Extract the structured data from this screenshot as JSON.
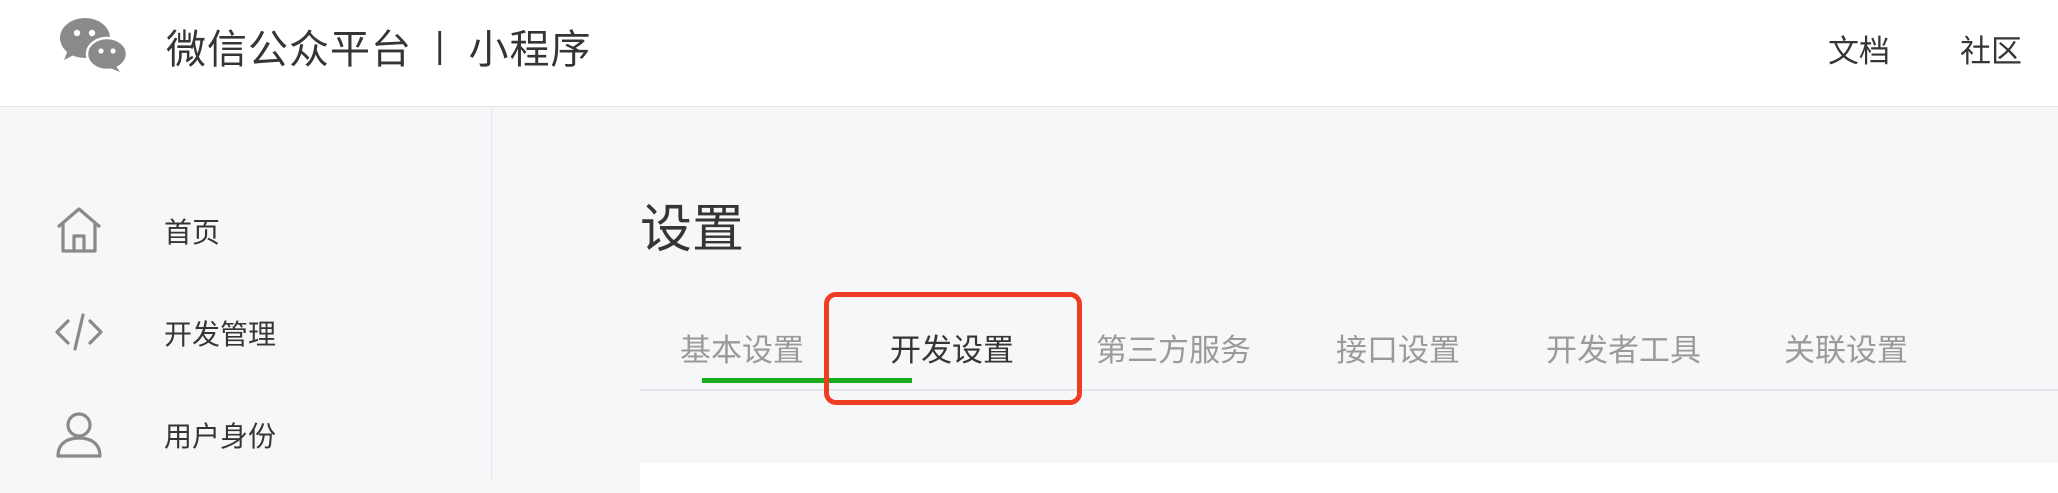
{
  "header": {
    "brand_name": "微信公众平台",
    "separator": "|",
    "product_name": "小程序",
    "nav": {
      "doc_label": "文档",
      "community_label": "社区"
    }
  },
  "sidebar": {
    "items": [
      {
        "label": "首页",
        "icon": "home-icon"
      },
      {
        "label": "开发管理",
        "icon": "code-icon"
      },
      {
        "label": "用户身份",
        "icon": "user-icon"
      }
    ]
  },
  "main": {
    "title": "设置",
    "tabs": [
      {
        "label": "基本设置",
        "active": false
      },
      {
        "label": "开发设置",
        "active": true
      },
      {
        "label": "第三方服务",
        "active": false
      },
      {
        "label": "接口设置",
        "active": false
      },
      {
        "label": "开发者工具",
        "active": false
      },
      {
        "label": "关联设置",
        "active": false
      }
    ]
  },
  "colors": {
    "accent_green": "#1aad19",
    "highlight_red": "#ee3d23",
    "text_primary": "#353535",
    "text_secondary": "#9a9a9a",
    "background": "#f6f7f9"
  }
}
